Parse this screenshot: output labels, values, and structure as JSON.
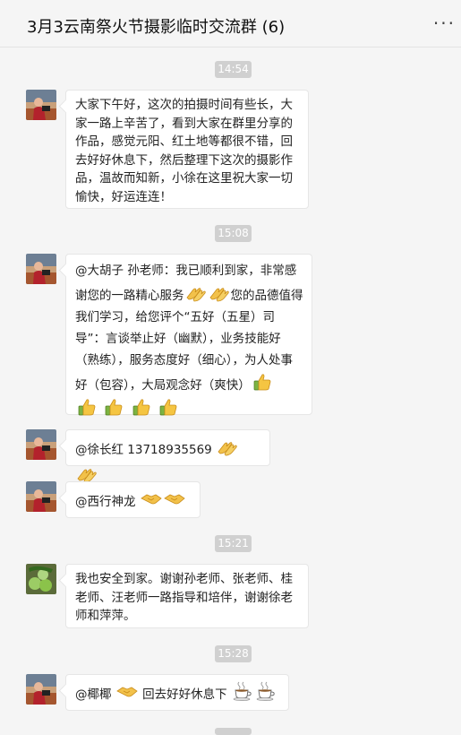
{
  "window": {
    "title": "3月3云南祭火节摄影临时交流群 (6)",
    "more": "···",
    "min": "—",
    "max": "☐",
    "close": "✕"
  },
  "messages": [
    {
      "time": "14:54",
      "text": "大家下午好，这次的拍摄时间有些长，大家一路上辛苦了，看到大家在群里分享的作品，感觉元阳、红土地等都很不错，回去好好休息下，然后整理下这次的摄影作品，温故而知新，小徐在这里祝大家一切愉快，好运连连！"
    },
    {
      "time": "15:08",
      "t1": "@大胡子 孙老师：我已顺利到家，非常感谢您的一路精心服务",
      "t2": "您的品德值得我们学习，给您评个“五好（五星）司导”：言谈举止好（幽默），业务技能好（熟练），服务态度好（细心），为人处事好（包容），大局观念好（爽快）"
    },
    {
      "text": "@徐长红 13718935569"
    },
    {
      "text": "@西行神龙"
    },
    {
      "time": "15:21",
      "text": "我也安全到家。谢谢孙老师、张老师、桂老师、汪老师一路指导和培伴，谢谢徐老师和萍萍。"
    },
    {
      "time": "15:28",
      "t1": "@椰椰",
      "t2": "回去好好休息下"
    }
  ]
}
